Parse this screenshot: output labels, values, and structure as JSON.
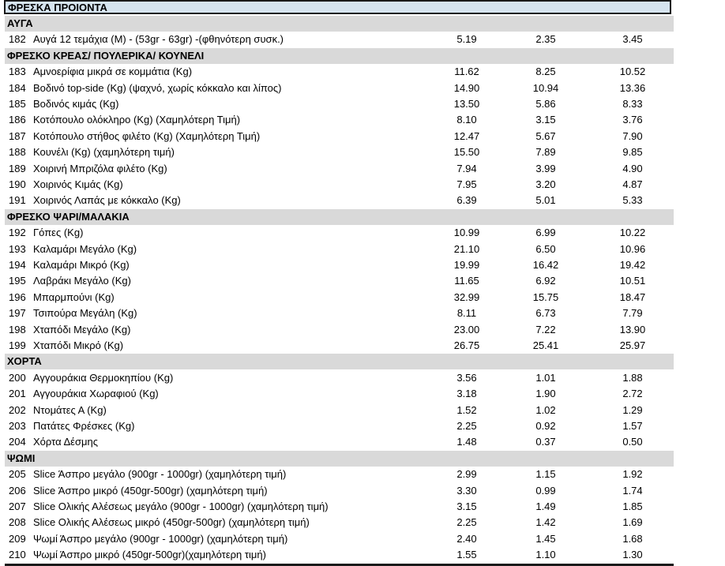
{
  "title": "ΦΡΕΣΚΑ ΠΡΟΙΟΝΤΑ",
  "sections": [
    {
      "name": "ΑΥΓΑ",
      "items": [
        {
          "code": "182",
          "name": "Αυγά 12 τεμάχια (M) - (53gr - 63gr) -(φθηνότερη συσκ.)",
          "v1": "5.19",
          "v2": "2.35",
          "v3": "3.45"
        }
      ]
    },
    {
      "name": "ΦΡΕΣΚΟ ΚΡΕΑΣ/ ΠΟΥΛΕΡΙΚΑ/ ΚΟΥΝΕΛΙ",
      "items": [
        {
          "code": "183",
          "name": "Αμνοερίφια μικρά σε κομμάτια (Kg)",
          "v1": "11.62",
          "v2": "8.25",
          "v3": "10.52"
        },
        {
          "code": "184",
          "name": "Βοδινό top-side (Kg) (ψαχνό, χωρίς κόκκαλο και λίπος)",
          "v1": "14.90",
          "v2": "10.94",
          "v3": "13.36"
        },
        {
          "code": "185",
          "name": "Βοδινός κιμάς (Kg)",
          "v1": "13.50",
          "v2": "5.86",
          "v3": "8.33"
        },
        {
          "code": "186",
          "name": "Κοτόπουλο ολόκληρο (Kg) (Χαμηλότερη Τιμή)",
          "v1": "8.10",
          "v2": "3.15",
          "v3": "3.76"
        },
        {
          "code": "187",
          "name": "Κοτόπουλο στήθος φιλέτο (Kg) (Χαμηλότερη Τιμή)",
          "v1": "12.47",
          "v2": "5.67",
          "v3": "7.90"
        },
        {
          "code": "188",
          "name": "Κουνέλι (Kg) (χαμηλότερη τιμή)",
          "v1": "15.50",
          "v2": "7.89",
          "v3": "9.85"
        },
        {
          "code": "189",
          "name": "Χοιρινή Μπριζόλα φιλέτο (Kg)",
          "v1": "7.94",
          "v2": "3.99",
          "v3": "4.90"
        },
        {
          "code": "190",
          "name": "Χοιρινός Κιμάς (Kg)",
          "v1": "7.95",
          "v2": "3.20",
          "v3": "4.87"
        },
        {
          "code": "191",
          "name": "Χοιρινός Λαπάς με κόκκαλο (Kg)",
          "v1": "6.39",
          "v2": "5.01",
          "v3": "5.33"
        }
      ]
    },
    {
      "name": "ΦΡΕΣΚΟ ΨΑΡΙ/ΜΑΛΑΚΙΑ",
      "items": [
        {
          "code": "192",
          "name": "Γόπες (Kg)",
          "v1": "10.99",
          "v2": "6.99",
          "v3": "10.22"
        },
        {
          "code": "193",
          "name": "Καλαμάρι Μεγάλο (Kg)",
          "v1": "21.10",
          "v2": "6.50",
          "v3": "10.96"
        },
        {
          "code": "194",
          "name": "Καλαμάρι Μικρό (Kg)",
          "v1": "19.99",
          "v2": "16.42",
          "v3": "19.42"
        },
        {
          "code": "195",
          "name": "Λαβράκι Μεγάλο (Kg)",
          "v1": "11.65",
          "v2": "6.92",
          "v3": "10.51"
        },
        {
          "code": "196",
          "name": "Μπαρμπούνι (Kg)",
          "v1": "32.99",
          "v2": "15.75",
          "v3": "18.47"
        },
        {
          "code": "197",
          "name": "Τσιπούρα Μεγάλη (Kg)",
          "v1": "8.11",
          "v2": "6.73",
          "v3": "7.79"
        },
        {
          "code": "198",
          "name": "Χταπόδι Μεγάλο (Kg)",
          "v1": "23.00",
          "v2": "7.22",
          "v3": "13.90"
        },
        {
          "code": "199",
          "name": "Χταπόδι Μικρό (Kg)",
          "v1": "26.75",
          "v2": "25.41",
          "v3": "25.97"
        }
      ]
    },
    {
      "name": "ΧΟΡΤΑ",
      "items": [
        {
          "code": "200",
          "name": "Αγγουράκια Θερμοκηπίου (Kg)",
          "v1": "3.56",
          "v2": "1.01",
          "v3": "1.88"
        },
        {
          "code": "201",
          "name": "Αγγουράκια Χωραφιού (Kg)",
          "v1": "3.18",
          "v2": "1.90",
          "v3": "2.72"
        },
        {
          "code": "202",
          "name": "Ντομάτες Α (Kg)",
          "v1": "1.52",
          "v2": "1.02",
          "v3": "1.29"
        },
        {
          "code": "203",
          "name": "Πατάτες Φρέσκες (Kg)",
          "v1": "2.25",
          "v2": "0.92",
          "v3": "1.57"
        },
        {
          "code": "204",
          "name": "Χόρτα Δέσμης",
          "v1": "1.48",
          "v2": "0.37",
          "v3": "0.50"
        }
      ]
    },
    {
      "name": "ΨΩΜΙ",
      "items": [
        {
          "code": "205",
          "name": "Slice Άσπρο μεγάλο (900gr - 1000gr) (χαμηλότερη τιμή)",
          "v1": "2.99",
          "v2": "1.15",
          "v3": "1.92"
        },
        {
          "code": "206",
          "name": "Slice Άσπρο μικρό (450gr-500gr) (χαμηλότερη τιμή)",
          "v1": "3.30",
          "v2": "0.99",
          "v3": "1.74"
        },
        {
          "code": "207",
          "name": "Slice Ολικής Αλέσεως μεγάλο (900gr - 1000gr) (χαμηλότερη τιμή)",
          "v1": "3.15",
          "v2": "1.49",
          "v3": "1.85"
        },
        {
          "code": "208",
          "name": "Slice Ολικής Αλέσεως μικρό (450gr-500gr) (χαμηλότερη τιμή)",
          "v1": "2.25",
          "v2": "1.42",
          "v3": "1.69"
        },
        {
          "code": "209",
          "name": "Ψωμί Άσπρο μεγάλο (900gr - 1000gr) (χαμηλότερη τιμή)",
          "v1": "2.40",
          "v2": "1.45",
          "v3": "1.68"
        },
        {
          "code": "210",
          "name": "Ψωμί Άσπρο μικρό (450gr-500gr)(χαμηλότερη τιμή)",
          "v1": "1.55",
          "v2": "1.10",
          "v3": "1.30"
        }
      ]
    }
  ]
}
